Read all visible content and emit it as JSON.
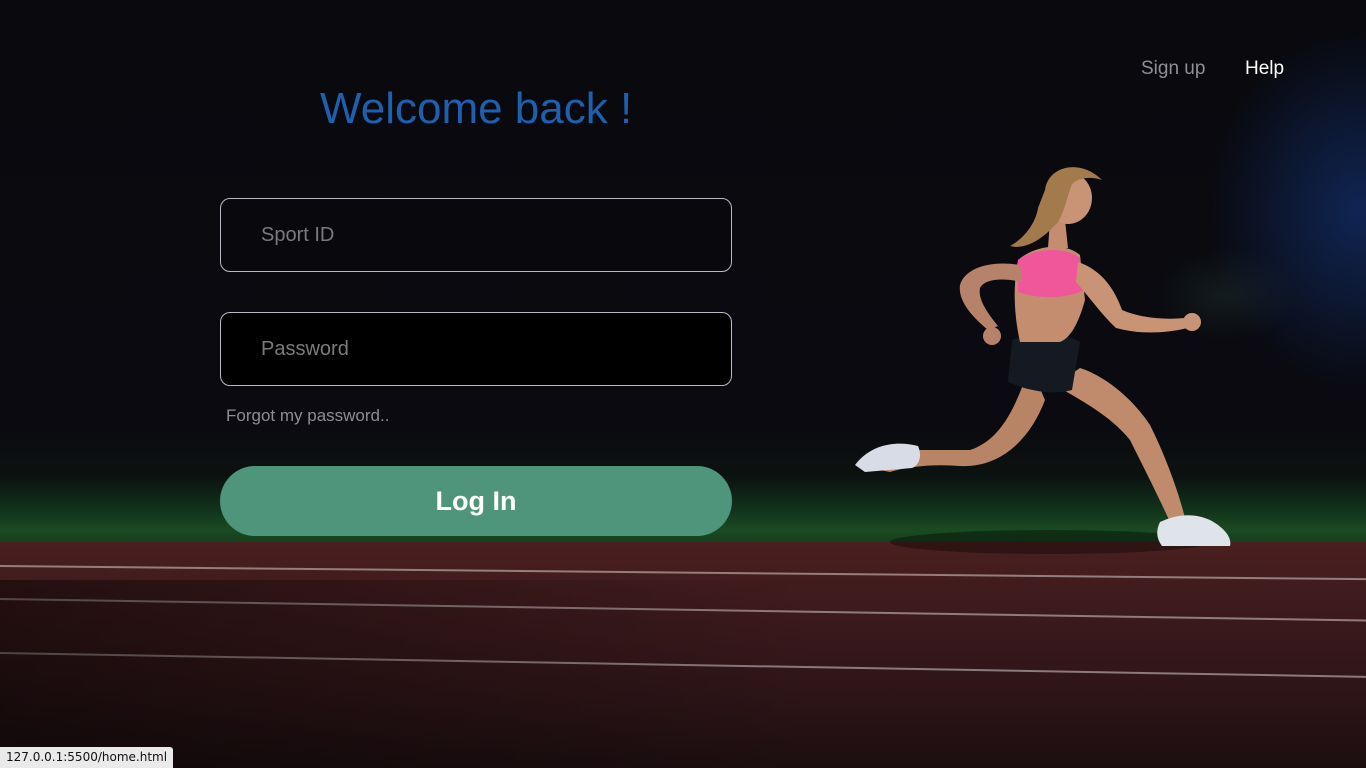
{
  "page": {
    "title": "Welcome back !"
  },
  "nav": {
    "signup_label": "Sign up",
    "help_label": "Help"
  },
  "form": {
    "sport_id": {
      "value": "",
      "placeholder": "Sport ID"
    },
    "password": {
      "value": "",
      "placeholder": "Password"
    },
    "forgot_label": "Forgot my password..",
    "login_label": "Log In"
  },
  "status_bar": {
    "url": "127.0.0.1:5500/home.html"
  },
  "colors": {
    "title": "#1e5fae",
    "login_button": "#4f957b",
    "background": "#07070b",
    "track": "#4a1f1f",
    "runner_top": "#f0579a"
  },
  "icons": {
    "hero_image": "runner-photo"
  }
}
